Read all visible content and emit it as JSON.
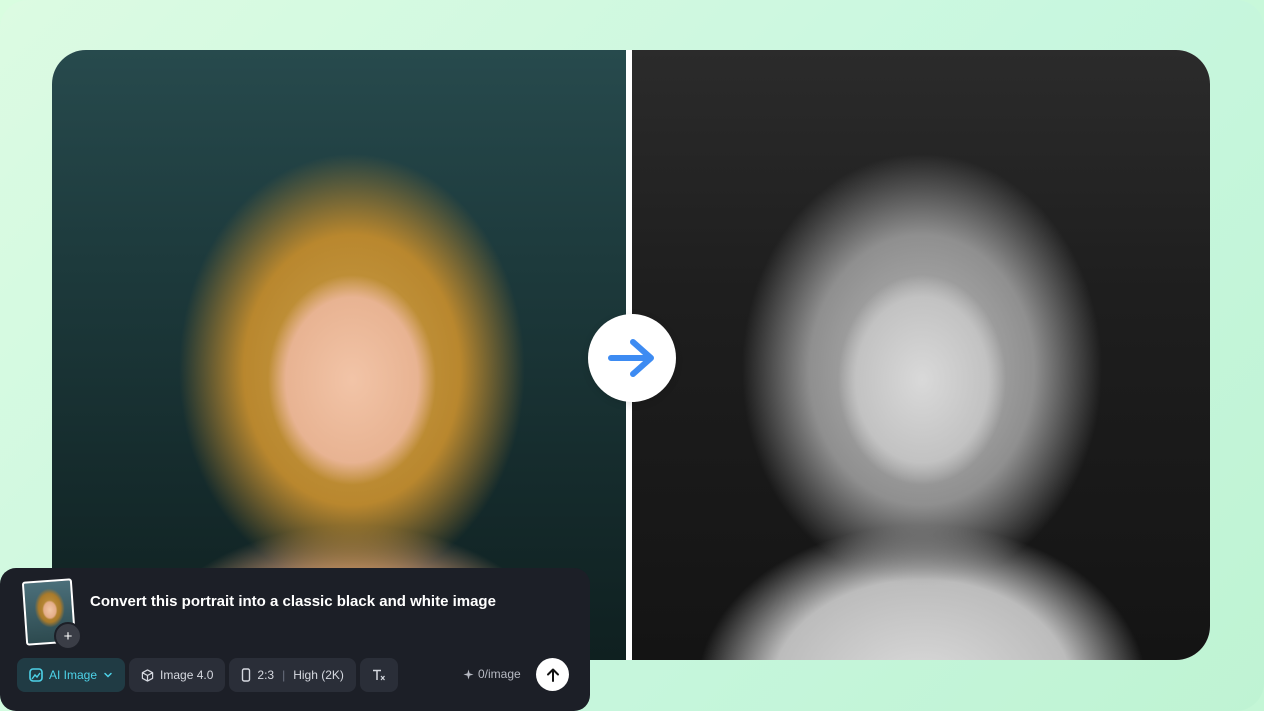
{
  "comparison": {
    "before_image": "portrait-color",
    "after_image": "portrait-black-and-white",
    "arrow_icon": "arrow-right-icon",
    "accent_color": "#3d8bf2"
  },
  "prompt": {
    "text": "Convert this portrait into a classic black and white image",
    "thumbnail_icon": "add-icon",
    "add_label": "+"
  },
  "toolbar": {
    "mode_label": "AI Image",
    "model_label": "Image 4.0",
    "aspect_ratio": "2:3",
    "quality": "High (2K)",
    "credits": "0/image",
    "mode_color": "#4dd2e8"
  }
}
